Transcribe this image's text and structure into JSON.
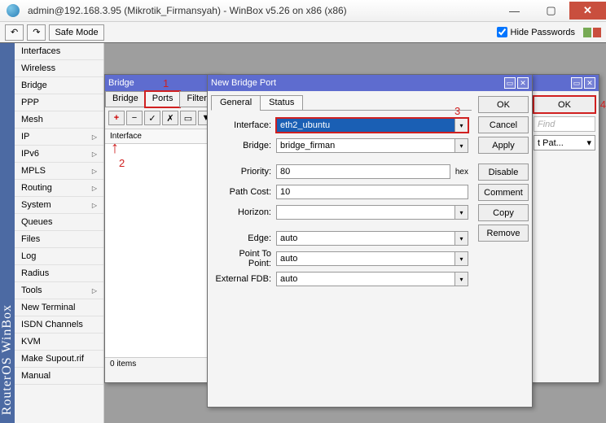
{
  "titlebar": {
    "title": "admin@192.168.3.95 (Mikrotik_Firmansyah) - WinBox v5.26 on x86 (x86)"
  },
  "toolbar": {
    "safe_mode": "Safe Mode",
    "hide_passwords": "Hide Passwords"
  },
  "sidebar_brand": "RouterOS WinBox",
  "menu": [
    {
      "label": "Interfaces",
      "arrow": false
    },
    {
      "label": "Wireless",
      "arrow": false
    },
    {
      "label": "Bridge",
      "arrow": false
    },
    {
      "label": "PPP",
      "arrow": false
    },
    {
      "label": "Mesh",
      "arrow": false
    },
    {
      "label": "IP",
      "arrow": true
    },
    {
      "label": "IPv6",
      "arrow": true
    },
    {
      "label": "MPLS",
      "arrow": true
    },
    {
      "label": "Routing",
      "arrow": true
    },
    {
      "label": "System",
      "arrow": true
    },
    {
      "label": "Queues",
      "arrow": false
    },
    {
      "label": "Files",
      "arrow": false
    },
    {
      "label": "Log",
      "arrow": false
    },
    {
      "label": "Radius",
      "arrow": false
    },
    {
      "label": "Tools",
      "arrow": true
    },
    {
      "label": "New Terminal",
      "arrow": false
    },
    {
      "label": "ISDN Channels",
      "arrow": false
    },
    {
      "label": "KVM",
      "arrow": false
    },
    {
      "label": "Make Supout.rif",
      "arrow": false
    },
    {
      "label": "Manual",
      "arrow": false
    }
  ],
  "bridge": {
    "title": "Bridge",
    "tabs": [
      "Bridge",
      "Ports",
      "Filters"
    ],
    "listhdr": "Interface",
    "status": "0 items"
  },
  "nbp": {
    "title": "New Bridge Port",
    "tabs": [
      "General",
      "Status"
    ],
    "labels": {
      "interface": "Interface:",
      "bridge": "Bridge:",
      "priority": "Priority:",
      "pathcost": "Path Cost:",
      "horizon": "Horizon:",
      "edge": "Edge:",
      "ptp": "Point To Point:",
      "efdb": "External FDB:"
    },
    "values": {
      "interface": "eth2_ubuntu",
      "bridge": "bridge_firman",
      "priority": "80",
      "pathcost": "10",
      "horizon": "",
      "edge": "auto",
      "ptp": "auto",
      "efdb": "auto"
    },
    "unit_hex": "hex",
    "buttons": {
      "ok": "OK",
      "cancel": "Cancel",
      "apply": "Apply",
      "disable": "Disable",
      "comment": "Comment",
      "copy": "Copy",
      "remove": "Remove"
    }
  },
  "sidewin": {
    "ok": "OK",
    "find": "Find",
    "sel": "t Pat..."
  },
  "annot": {
    "a1": "1",
    "a2": "2",
    "a3": "3",
    "a4": "4"
  }
}
